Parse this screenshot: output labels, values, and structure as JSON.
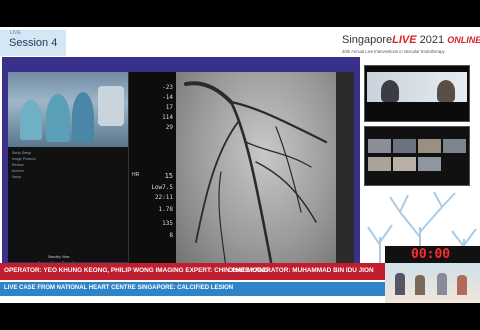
{
  "header": {
    "session_small": "LIVE",
    "session_title": "Session 4",
    "logo_prefix": "Singapore",
    "logo_live": "LIVE",
    "logo_year": " 2021 ",
    "logo_online": "ONLINE",
    "logo_sub": "30th Annual Live Interventions in Vascular Endotherapy"
  },
  "monitor": {
    "rows": [
      {
        "label": "",
        "value": "-23"
      },
      {
        "label": "",
        "value": "-14"
      },
      {
        "label": "",
        "value": "17"
      },
      {
        "label": "",
        "value": "114"
      },
      {
        "label": "",
        "value": "29"
      },
      {
        "label": "HR",
        "value": "15"
      },
      {
        "label": "",
        "value": "Low7.5"
      },
      {
        "label": "",
        "value": "22:11"
      },
      {
        "label": "",
        "value": "1.78"
      },
      {
        "label": "",
        "value": "135"
      },
      {
        "label": "",
        "value": "8"
      }
    ],
    "ctrl_title": "Standby View",
    "ctrl_sub": "Current Room: Room 3",
    "ctrl_menu": [
      "Study Setup",
      "Image Protocol",
      "Review",
      "Archive",
      "Setup"
    ]
  },
  "clock": {
    "value": "00:00"
  },
  "banner": {
    "operator": "OPERATOR: YEO KHUNG KEONG, PHILIP WONG IMAGING EXPERT: CHIN CHEE YANG",
    "moderator": "CHAT MODERATOR: MUHAMMAD BIN IDU JION",
    "live_case": "LIVE CASE FROM NATIONAL HEART CENTRE SINGAPORE: CALCIFIED LESION"
  },
  "colors": {
    "accent_red": "#be1e2d",
    "accent_blue": "#2e84c6",
    "panel_purple": "#38308a",
    "clock_red": "#ff2b2b"
  }
}
